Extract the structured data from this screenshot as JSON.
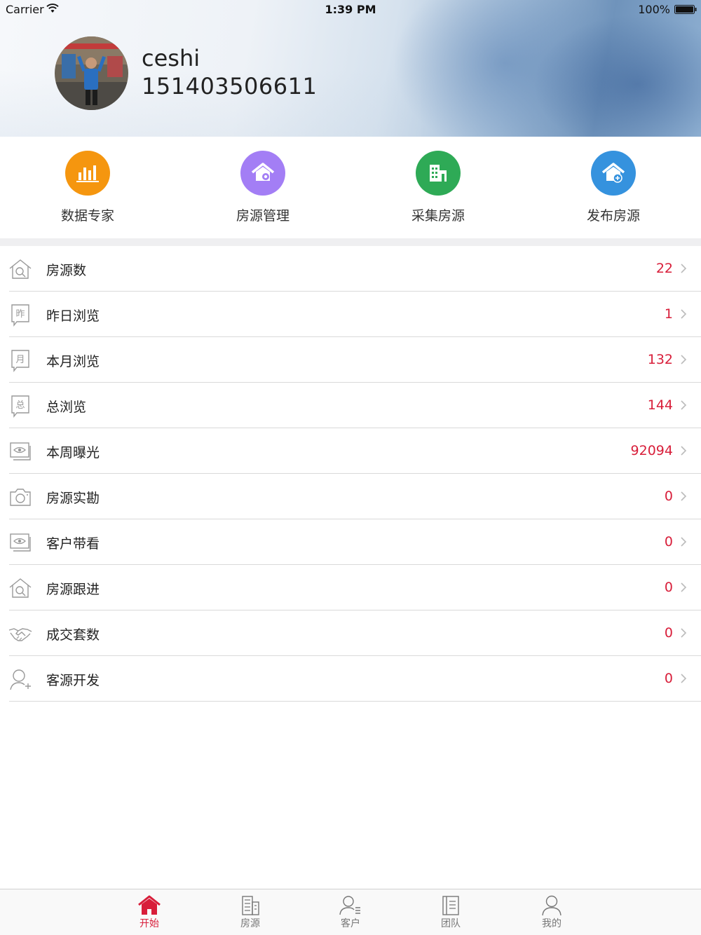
{
  "status_bar": {
    "carrier": "Carrier",
    "time": "1:39 PM",
    "battery": "100%"
  },
  "profile": {
    "name": "ceshi",
    "phone": "151403506611"
  },
  "colors": {
    "accent": "#d81e3a",
    "orange": "#f5960f",
    "purple": "#a37ef5",
    "green": "#2eaa56",
    "blue": "#3592de"
  },
  "quick_actions": [
    {
      "label": "数据专家",
      "icon": "bar-chart-icon",
      "color": "#f5960f"
    },
    {
      "label": "房源管理",
      "icon": "house-gear-icon",
      "color": "#a37ef5"
    },
    {
      "label": "采集房源",
      "icon": "building-icon",
      "color": "#2eaa56"
    },
    {
      "label": "发布房源",
      "icon": "house-plus-icon",
      "color": "#3592de"
    }
  ],
  "stats": [
    {
      "label": "房源数",
      "value": "22",
      "icon": "house-search-icon"
    },
    {
      "label": "昨日浏览",
      "value": "1",
      "icon": "yesterday-icon",
      "icon_char": "昨"
    },
    {
      "label": "本月浏览",
      "value": "132",
      "icon": "month-icon",
      "icon_char": "月"
    },
    {
      "label": "总浏览",
      "value": "144",
      "icon": "total-icon",
      "icon_char": "总"
    },
    {
      "label": "本周曝光",
      "value": "92094",
      "icon": "eye-screen-icon"
    },
    {
      "label": "房源实勘",
      "value": "0",
      "icon": "camera-icon"
    },
    {
      "label": "客户带看",
      "value": "0",
      "icon": "eye-screen-icon"
    },
    {
      "label": "房源跟进",
      "value": "0",
      "icon": "house-search-icon"
    },
    {
      "label": "成交套数",
      "value": "0",
      "icon": "handshake-icon"
    },
    {
      "label": "客源开发",
      "value": "0",
      "icon": "user-plus-icon"
    }
  ],
  "tabs": [
    {
      "label": "开始",
      "icon": "home-icon",
      "active": true
    },
    {
      "label": "房源",
      "icon": "buildings-icon",
      "active": false
    },
    {
      "label": "客户",
      "icon": "customer-icon",
      "active": false
    },
    {
      "label": "团队",
      "icon": "team-book-icon",
      "active": false
    },
    {
      "label": "我的",
      "icon": "person-icon",
      "active": false
    }
  ]
}
